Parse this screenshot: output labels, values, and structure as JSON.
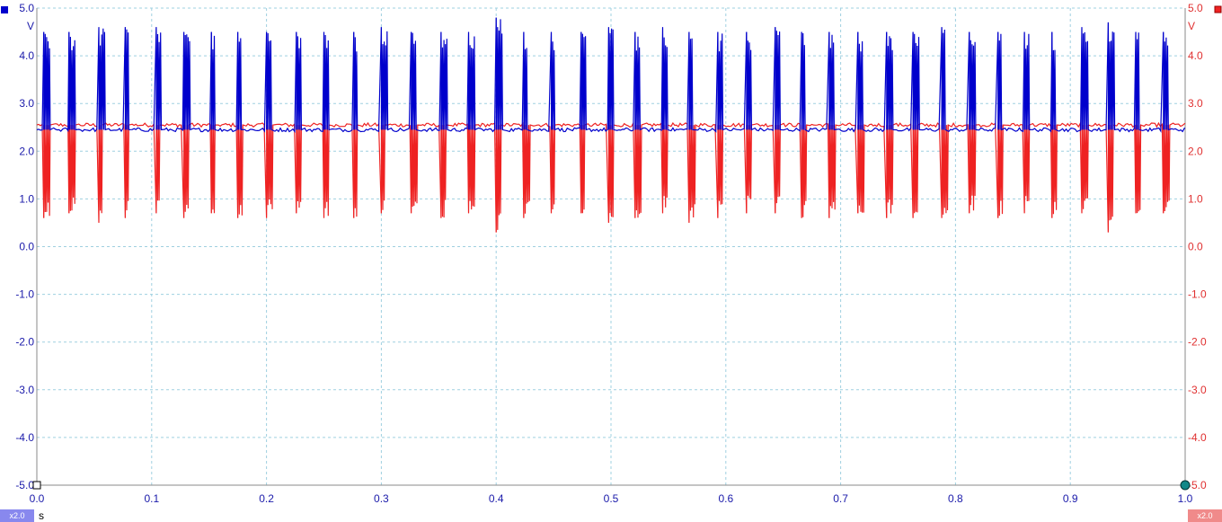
{
  "chart_data": {
    "type": "line",
    "x_unit": "s",
    "y_unit_left": "V",
    "y_unit_right": "V",
    "xlim": [
      0.0,
      1.0
    ],
    "ylim": [
      -5.0,
      5.0
    ],
    "x_ticks": [
      "0.0",
      "0.1",
      "0.2",
      "0.3",
      "0.4",
      "0.5",
      "0.6",
      "0.7",
      "0.8",
      "0.9",
      "1.0"
    ],
    "y_ticks_left": [
      "5.0",
      "4.0",
      "3.0",
      "2.0",
      "1.0",
      "0.0",
      "-1.0",
      "-2.0",
      "-3.0",
      "-4.0",
      "-5.0"
    ],
    "y_ticks_right": [
      "5.0",
      "4.0",
      "3.0",
      "2.0",
      "1.0",
      "0.0",
      "-1.0",
      "-2.0",
      "-3.0",
      "-4.0",
      "-5.0"
    ],
    "grid": true,
    "series": [
      {
        "channel": "A",
        "color": "#0000cc",
        "baseline_v": 2.45,
        "burst_times_s": [
          0.006,
          0.028,
          0.054,
          0.077,
          0.104,
          0.128,
          0.152,
          0.175,
          0.2,
          0.226,
          0.25,
          0.276,
          0.3,
          0.326,
          0.352,
          0.376,
          0.4,
          0.424,
          0.448,
          0.474,
          0.498,
          0.521,
          0.545,
          0.568,
          0.593,
          0.618,
          0.643,
          0.666,
          0.69,
          0.715,
          0.74,
          0.763,
          0.788,
          0.812,
          0.837,
          0.86,
          0.884,
          0.91,
          0.933,
          0.957,
          0.981
        ],
        "spike_peak_v": [
          4.5,
          4.5,
          4.6,
          4.6,
          4.6,
          4.5,
          4.5,
          4.5,
          4.5,
          4.5,
          4.5,
          4.5,
          4.6,
          4.5,
          4.5,
          4.5,
          4.8,
          4.5,
          4.5,
          4.5,
          4.6,
          4.5,
          4.6,
          4.5,
          4.5,
          4.5,
          4.6,
          4.5,
          4.5,
          4.5,
          4.5,
          4.5,
          4.6,
          4.5,
          4.5,
          4.5,
          4.5,
          4.6,
          4.7,
          4.5,
          4.5
        ]
      },
      {
        "channel": "B",
        "color": "#ee2222",
        "baseline_v": 2.55,
        "burst_times_s": [
          0.006,
          0.028,
          0.054,
          0.077,
          0.104,
          0.128,
          0.152,
          0.175,
          0.2,
          0.226,
          0.25,
          0.276,
          0.3,
          0.326,
          0.352,
          0.376,
          0.4,
          0.424,
          0.448,
          0.474,
          0.498,
          0.521,
          0.545,
          0.568,
          0.593,
          0.618,
          0.643,
          0.666,
          0.69,
          0.715,
          0.74,
          0.763,
          0.788,
          0.812,
          0.837,
          0.86,
          0.884,
          0.91,
          0.933,
          0.957,
          0.981
        ],
        "spike_trough_v": [
          0.6,
          0.7,
          0.5,
          0.6,
          0.7,
          0.6,
          0.7,
          0.6,
          0.6,
          0.7,
          0.6,
          0.6,
          0.7,
          0.7,
          0.6,
          0.7,
          0.3,
          0.6,
          0.7,
          0.7,
          0.5,
          0.6,
          0.7,
          0.5,
          0.6,
          0.7,
          0.7,
          0.6,
          0.6,
          0.7,
          0.6,
          0.6,
          0.6,
          0.7,
          0.6,
          0.7,
          0.6,
          0.7,
          0.3,
          0.7,
          0.7
        ]
      }
    ]
  },
  "scale_badge_left": "x2.0",
  "scale_badge_right": "x2.0",
  "x_unit_label": "s"
}
